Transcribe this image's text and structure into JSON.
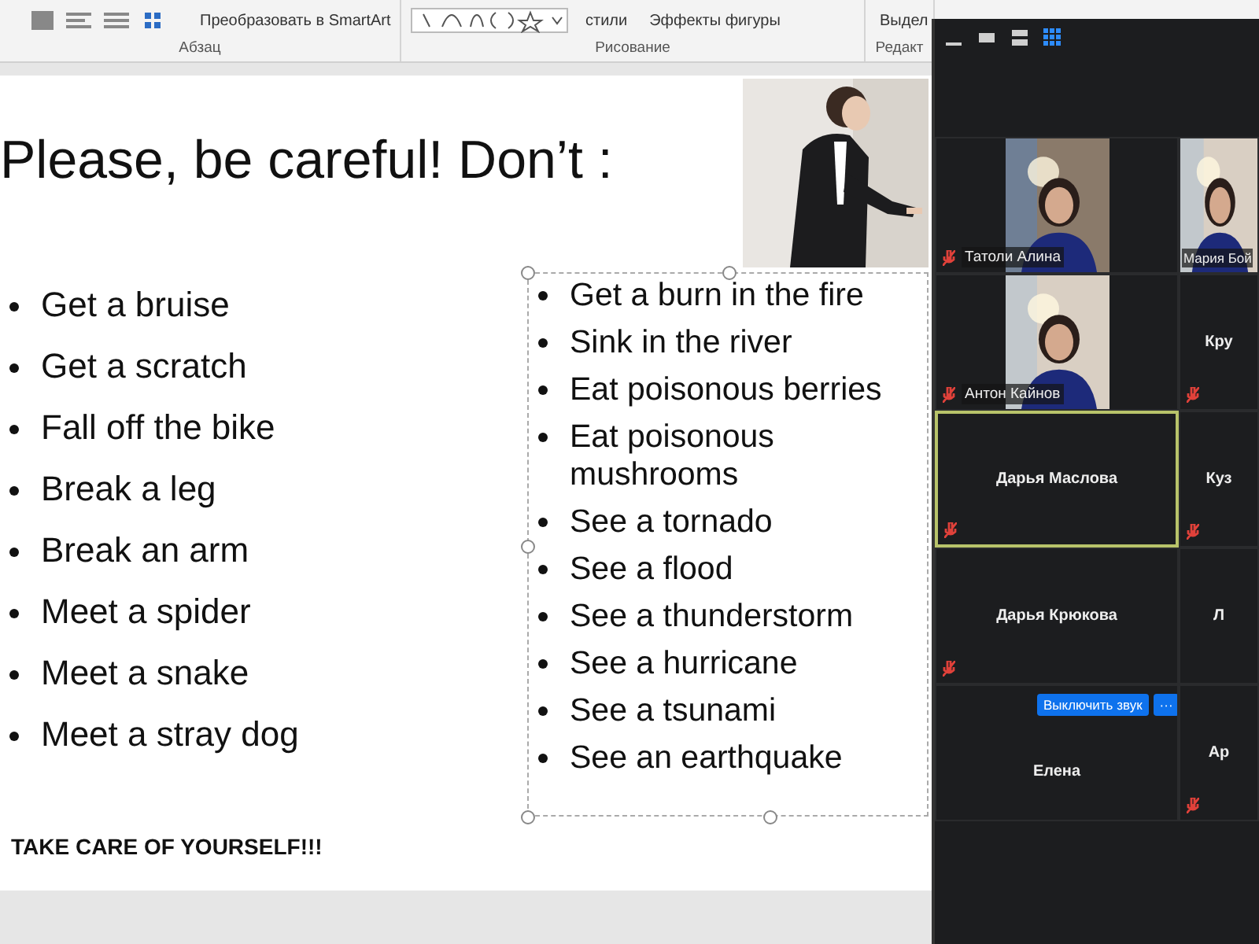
{
  "ribbon": {
    "groups": [
      {
        "label": "Абзац",
        "buttons": [
          "Преобразовать в SmartArt"
        ]
      },
      {
        "label": "Рисование",
        "buttons": [
          "стили",
          "Эффекты фигуры"
        ]
      },
      {
        "label": "Редакт",
        "buttons": [
          "Выдел"
        ]
      }
    ]
  },
  "slide": {
    "title": "Please, be careful! Don’t :",
    "left_list": [
      "Get a bruise",
      "Get a scratch",
      "Fall off the bike",
      "Break a leg",
      "Break an arm",
      "Meet a spider",
      "Meet a snake",
      "Meet a stray dog"
    ],
    "right_list": [
      "Get a burn in the fire",
      "Sink in the river",
      "Eat poisonous berries",
      "Eat poisonous mushrooms",
      "See a tornado",
      "See a flood",
      "See a thunderstorm",
      "See a hurricane",
      "See a tsunami",
      "See an earthquake"
    ],
    "footer": "TAKE CARE OF YOURSELF!!!"
  },
  "meeting": {
    "view_buttons": [
      {
        "selected": false
      },
      {
        "selected": false
      },
      {
        "selected": false
      },
      {
        "selected": true
      }
    ],
    "participants": [
      {
        "name": "Татоли Алина",
        "kind": "video",
        "muted": true,
        "selected": false
      },
      {
        "name": "Мария Бой",
        "kind": "video",
        "muted": false,
        "selected": false
      },
      {
        "name": "Антон Кайнов",
        "kind": "video",
        "muted": true,
        "selected": false
      },
      {
        "name": "Кру",
        "kind": "name",
        "muted": true,
        "selected": false
      },
      {
        "name": "Дарья Маслова",
        "kind": "name",
        "muted": true,
        "selected": true
      },
      {
        "name": "Куз",
        "kind": "name",
        "muted": true,
        "selected": false
      },
      {
        "name": "Дарья Крюкова",
        "kind": "name",
        "muted": true,
        "selected": false
      },
      {
        "name": "Л",
        "kind": "name",
        "muted": false,
        "selected": false
      },
      {
        "name": "Елена",
        "kind": "name",
        "muted": false,
        "selected": false,
        "hover_buttons": [
          "Выключить звук",
          "···"
        ]
      },
      {
        "name": "Ар",
        "kind": "name",
        "muted": true,
        "selected": false
      }
    ]
  }
}
